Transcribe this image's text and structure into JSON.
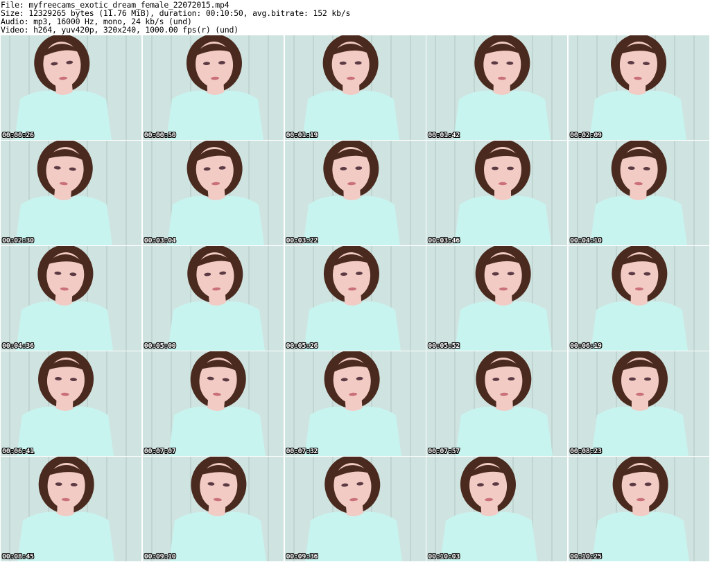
{
  "header": {
    "file_line": "File: myfreecams_exotic_dream_female_22072015.mp4",
    "size_line": "Size: 12329265 bytes (11.76 MiB), duration: 00:10:50, avg.bitrate: 152 kb/s",
    "audio_line": "Audio: mp3, 16000 Hz, mono, 24 kb/s (und)",
    "video_line": "Video: h264, yuv420p, 320x240, 1000.00 fps(r) (und)"
  },
  "thumbnails": [
    {
      "timestamp": "00:00:26"
    },
    {
      "timestamp": "00:00:50"
    },
    {
      "timestamp": "00:01:19"
    },
    {
      "timestamp": "00:01:42"
    },
    {
      "timestamp": "00:02:09"
    },
    {
      "timestamp": "00:02:30"
    },
    {
      "timestamp": "00:03:04"
    },
    {
      "timestamp": "00:03:22"
    },
    {
      "timestamp": "00:03:46"
    },
    {
      "timestamp": "00:04:10"
    },
    {
      "timestamp": "00:04:36"
    },
    {
      "timestamp": "00:05:00"
    },
    {
      "timestamp": "00:05:26"
    },
    {
      "timestamp": "00:05:52"
    },
    {
      "timestamp": "00:06:19"
    },
    {
      "timestamp": "00:06:41"
    },
    {
      "timestamp": "00:07:07"
    },
    {
      "timestamp": "00:07:32"
    },
    {
      "timestamp": "00:07:57"
    },
    {
      "timestamp": "00:08:23"
    },
    {
      "timestamp": "00:08:45"
    },
    {
      "timestamp": "00:09:10"
    },
    {
      "timestamp": "00:09:36"
    },
    {
      "timestamp": "00:10:03"
    },
    {
      "timestamp": "00:10:25"
    }
  ],
  "colors": {
    "background_wall": "#cfe3e0",
    "shirt": "#c8f4f0",
    "hair": "#4a2a1e",
    "skin": "#f2cbc4",
    "timestamp_text": "#ffffff"
  }
}
